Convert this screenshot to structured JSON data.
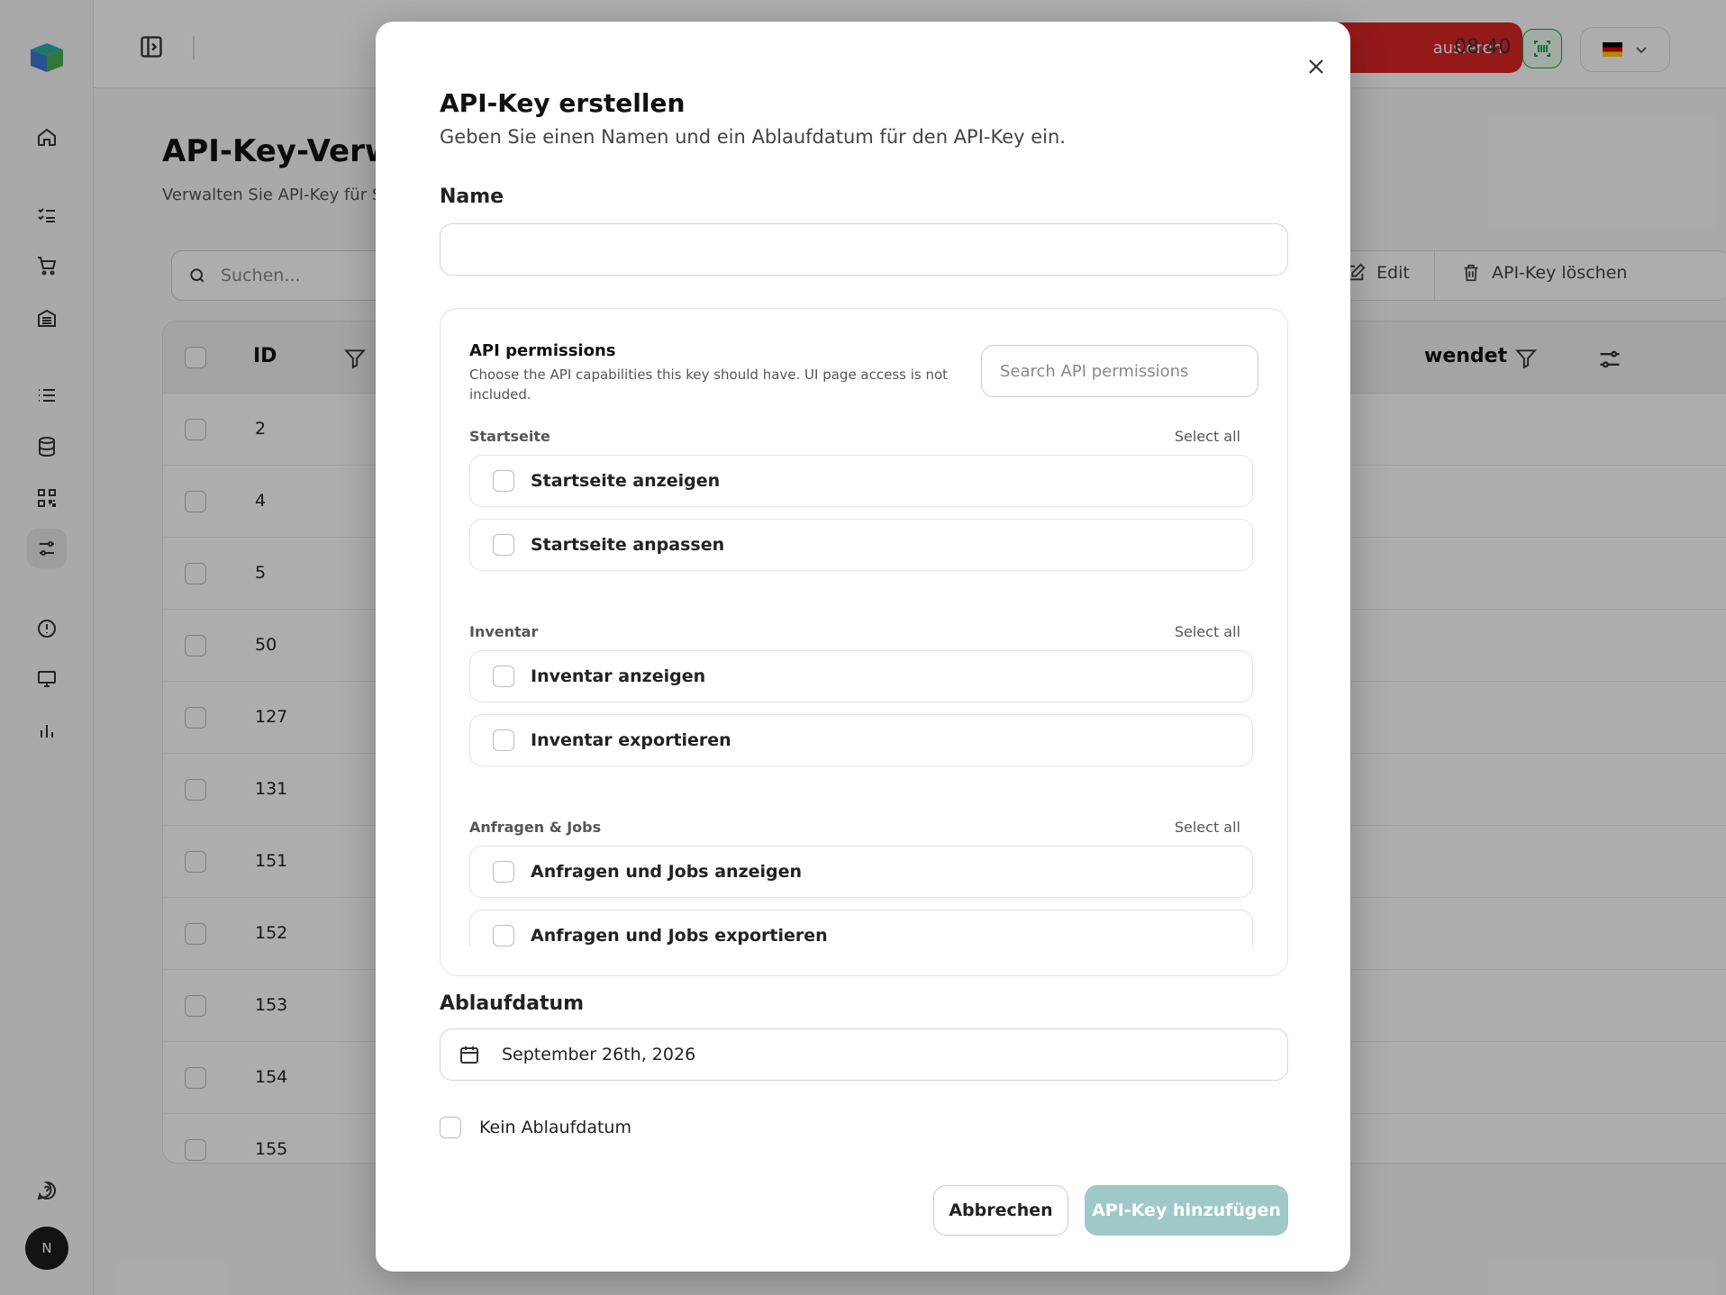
{
  "topbar": {
    "red_button_label": "ausieren",
    "time": "08:40"
  },
  "page": {
    "title": "API-Key-Verwal",
    "subtitle": "Verwalten Sie API-Key für S",
    "search_placeholder": "Suchen...",
    "edit_label": "Edit",
    "delete_label": "API-Key löschen"
  },
  "table": {
    "col_id": "ID",
    "col_used": "wendet",
    "rows": [
      "2",
      "4",
      "5",
      "50",
      "127",
      "131",
      "151",
      "152",
      "153",
      "154",
      "155"
    ]
  },
  "avatar_initial": "N",
  "modal": {
    "title": "API-Key erstellen",
    "description": "Geben Sie einen Namen und ein Ablaufdatum für den API-Key ein.",
    "name_label": "Name",
    "name_value": "",
    "permissions": {
      "title": "API permissions",
      "description": "Choose the API capabilities this key should have. UI page access is not included.",
      "search_placeholder": "Search API permissions",
      "select_all_label": "Select all",
      "groups": [
        {
          "name": "Startseite",
          "select_all": "Select all",
          "items": [
            "Startseite anzeigen",
            "Startseite anpassen"
          ]
        },
        {
          "name": "Inventar",
          "select_all": "Select all",
          "items": [
            "Inventar anzeigen",
            "Inventar exportieren"
          ]
        },
        {
          "name": "Anfragen & Jobs",
          "select_all": "Select all",
          "items": [
            "Anfragen und Jobs anzeigen",
            "Anfragen und Jobs exportieren"
          ]
        }
      ]
    },
    "expiry_label": "Ablaufdatum",
    "expiry_value": "September 26th, 2026",
    "no_expiry_label": "Kein Ablaufdatum",
    "cancel_label": "Abbrechen",
    "submit_label": "API-Key hinzufügen"
  },
  "colors": {
    "accent": "#9fc8c8",
    "danger": "#dc2626",
    "success": "#16a34a"
  }
}
